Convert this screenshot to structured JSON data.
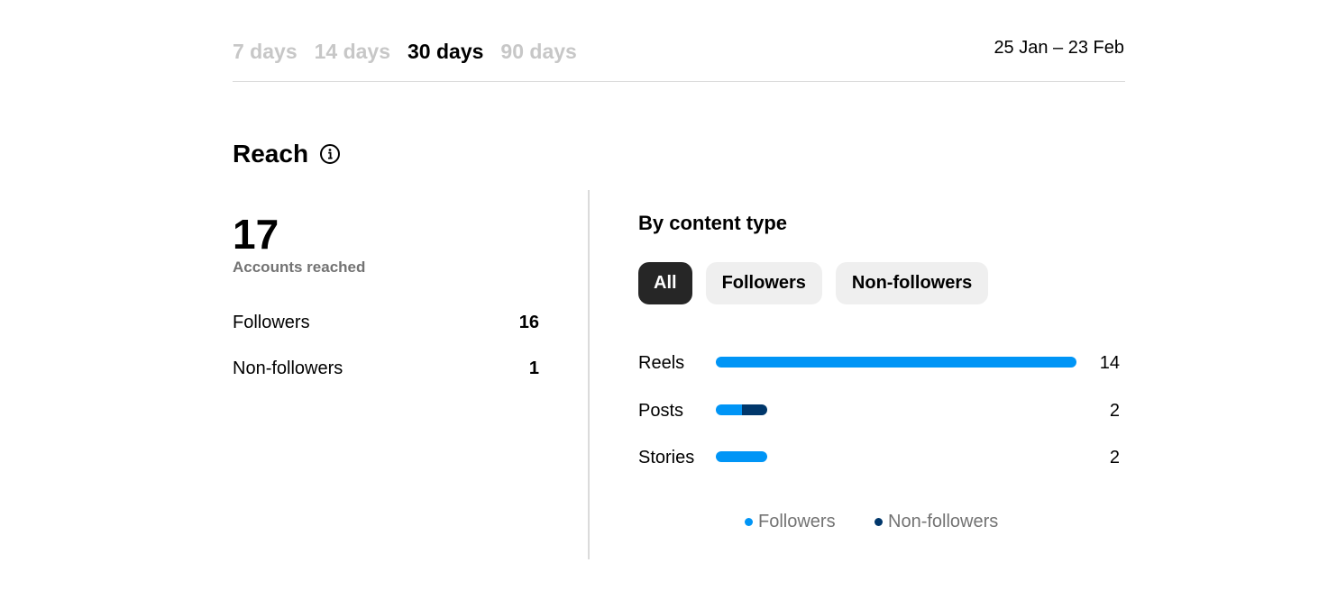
{
  "period_tabs": [
    "7 days",
    "14 days",
    "30 days",
    "90 days"
  ],
  "active_period": "30 days",
  "date_range": "25 Jan – 23 Feb",
  "section_title": "Reach",
  "summary": {
    "total": "17",
    "total_label": "Accounts reached",
    "rows": [
      {
        "label": "Followers",
        "value": "16"
      },
      {
        "label": "Non-followers",
        "value": "1"
      }
    ]
  },
  "by_content": {
    "title": "By content type",
    "filters": [
      "All",
      "Followers",
      "Non-followers"
    ],
    "active_filter": "All"
  },
  "colors": {
    "followers": "#0095f6",
    "non_followers": "#00376b"
  },
  "chart_data": {
    "type": "bar",
    "orientation": "horizontal",
    "stacked": true,
    "categories": [
      "Reels",
      "Posts",
      "Stories"
    ],
    "totals": [
      14,
      2,
      2
    ],
    "series": [
      {
        "name": "Followers",
        "values": [
          14,
          1,
          2
        ]
      },
      {
        "name": "Non-followers",
        "values": [
          0,
          1,
          0
        ]
      }
    ],
    "legend": [
      "Followers",
      "Non-followers"
    ]
  }
}
